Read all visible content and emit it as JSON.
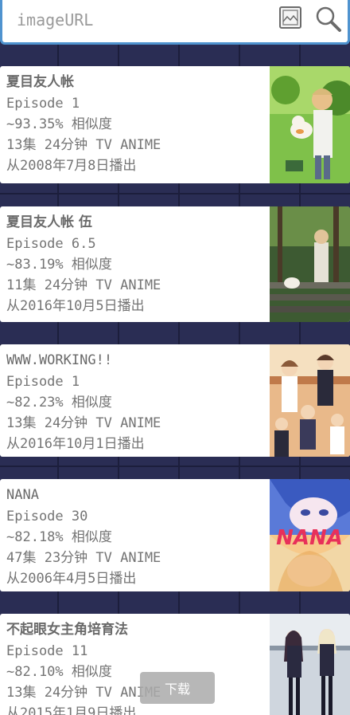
{
  "search": {
    "placeholder": "imageURL",
    "value": ""
  },
  "results": [
    {
      "title": "夏目友人帐",
      "episode": "Episode 1",
      "similarity": "~93.35% 相似度",
      "info": "13集 24分钟 TV ANIME",
      "aired": "从2008年7月8日播出"
    },
    {
      "title": "夏目友人帐 伍",
      "episode": "Episode 6.5",
      "similarity": "~83.19% 相似度",
      "info": "11集 24分钟 TV ANIME",
      "aired": "从2016年10月5日播出"
    },
    {
      "title": "WWW.WORKING!!",
      "episode": "Episode 1",
      "similarity": "~82.23% 相似度",
      "info": "13集 24分钟 TV ANIME",
      "aired": "从2016年10月1日播出"
    },
    {
      "title": "NANA",
      "episode": "Episode 30",
      "similarity": "~82.18% 相似度",
      "info": "47集 23分钟 TV ANIME",
      "aired": "从2006年4月5日播出"
    },
    {
      "title": "不起眼女主角培育法",
      "episode": "Episode 11",
      "similarity": "~82.10% 相似度",
      "info": "13集 24分钟 TV ANIME",
      "aired": "从2015年1月9日播出"
    }
  ],
  "thumbnail_logo_text": "NANA",
  "download_label": "下载",
  "colors": {
    "accent": "#4f93cf",
    "background": "#2a2d54",
    "card": "#ffffff",
    "text": "#6a6a6a"
  },
  "icons": {
    "image_button": "image-icon",
    "search_button": "search-icon"
  }
}
